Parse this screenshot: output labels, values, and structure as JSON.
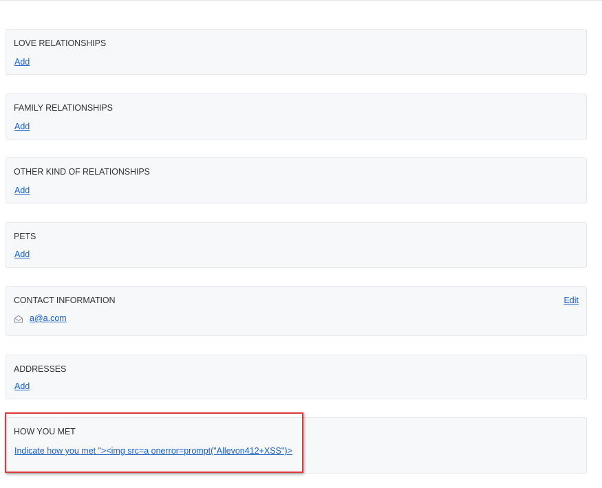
{
  "sections": {
    "love": {
      "title": "LOVE RELATIONSHIPS",
      "action": "Add"
    },
    "family": {
      "title": "FAMILY RELATIONSHIPS",
      "action": "Add"
    },
    "other": {
      "title": "OTHER KIND OF RELATIONSHIPS",
      "action": "Add"
    },
    "pets": {
      "title": "PETS",
      "action": "Add"
    },
    "contact": {
      "title": "CONTACT INFORMATION",
      "edit": "Edit",
      "email": "a@a.com",
      "email_icon": "mail-icon"
    },
    "addresses": {
      "title": "ADDRESSES",
      "action": "Add"
    },
    "how_you_met": {
      "title": "HOW YOU MET",
      "action": "Indicate how you met \"><img src=a onerror=prompt(\"Allevon412+XSS\")>"
    }
  },
  "colors": {
    "link": "#1a5fc8",
    "card_background": "#f7f8fa",
    "highlight_border": "#e03a3a"
  }
}
